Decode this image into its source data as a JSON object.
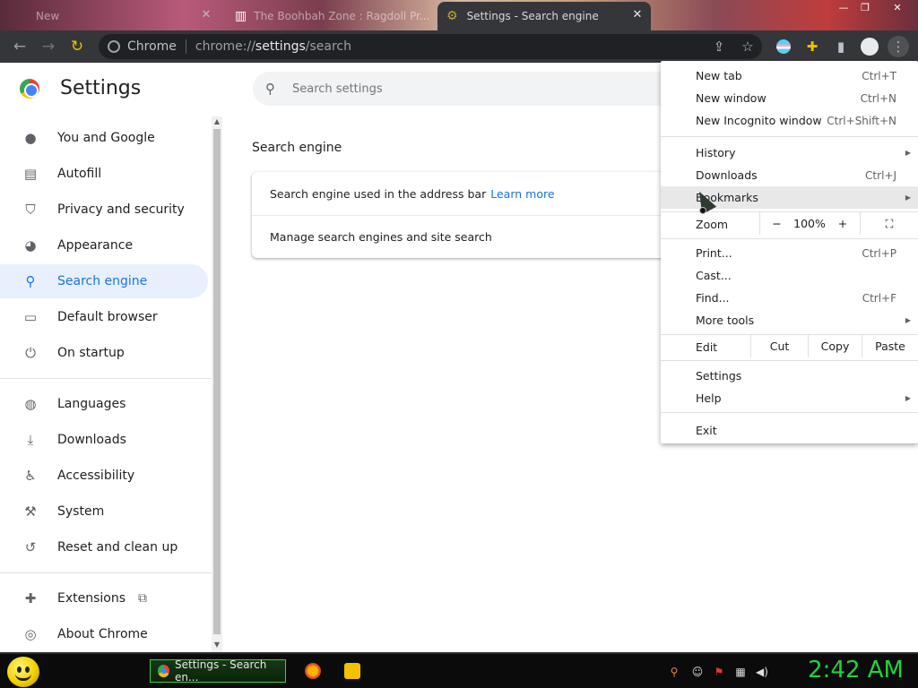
{
  "tabs": [
    {
      "title": "New"
    },
    {
      "title": "The Boohbah Zone : Ragdoll Pr..."
    },
    {
      "title": "Settings - Search engine"
    }
  ],
  "toolbar": {
    "site_label": "Chrome",
    "url_prefix": "chrome://",
    "url_host": "settings",
    "url_path": "/search"
  },
  "header": {
    "title": "Settings",
    "search_placeholder": "Search settings"
  },
  "sidebar": {
    "items": [
      {
        "label": "You and Google"
      },
      {
        "label": "Autofill"
      },
      {
        "label": "Privacy and security"
      },
      {
        "label": "Appearance"
      },
      {
        "label": "Search engine"
      },
      {
        "label": "Default browser"
      },
      {
        "label": "On startup"
      },
      {
        "label": "Languages"
      },
      {
        "label": "Downloads"
      },
      {
        "label": "Accessibility"
      },
      {
        "label": "System"
      },
      {
        "label": "Reset and clean up"
      },
      {
        "label": "Extensions"
      },
      {
        "label": "About Chrome"
      }
    ]
  },
  "main": {
    "section_title": "Search engine",
    "row1_text": "Search engine used in the address bar",
    "row1_link": "Learn more",
    "row2_text": "Manage search engines and site search"
  },
  "menu": {
    "new_tab": "New tab",
    "new_tab_sc": "Ctrl+T",
    "new_window": "New window",
    "new_window_sc": "Ctrl+N",
    "new_incognito": "New Incognito window",
    "new_incognito_sc": "Ctrl+Shift+N",
    "history": "History",
    "downloads": "Downloads",
    "downloads_sc": "Ctrl+J",
    "bookmarks": "Bookmarks",
    "zoom": "Zoom",
    "zoom_minus": "−",
    "zoom_value": "100%",
    "zoom_plus": "+",
    "print": "Print...",
    "print_sc": "Ctrl+P",
    "cast": "Cast...",
    "find": "Find...",
    "find_sc": "Ctrl+F",
    "more_tools": "More tools",
    "edit": "Edit",
    "cut": "Cut",
    "copy": "Copy",
    "paste": "Paste",
    "settings": "Settings",
    "help": "Help",
    "exit": "Exit"
  },
  "taskbar": {
    "task_label": "Settings - Search en...",
    "clock": "2:42 AM"
  },
  "colors": {
    "accent": "#1a73e8",
    "selected_bg": "#e8f0fe",
    "toolbar_bg": "#35363a",
    "clock_green": "#21d33b"
  }
}
